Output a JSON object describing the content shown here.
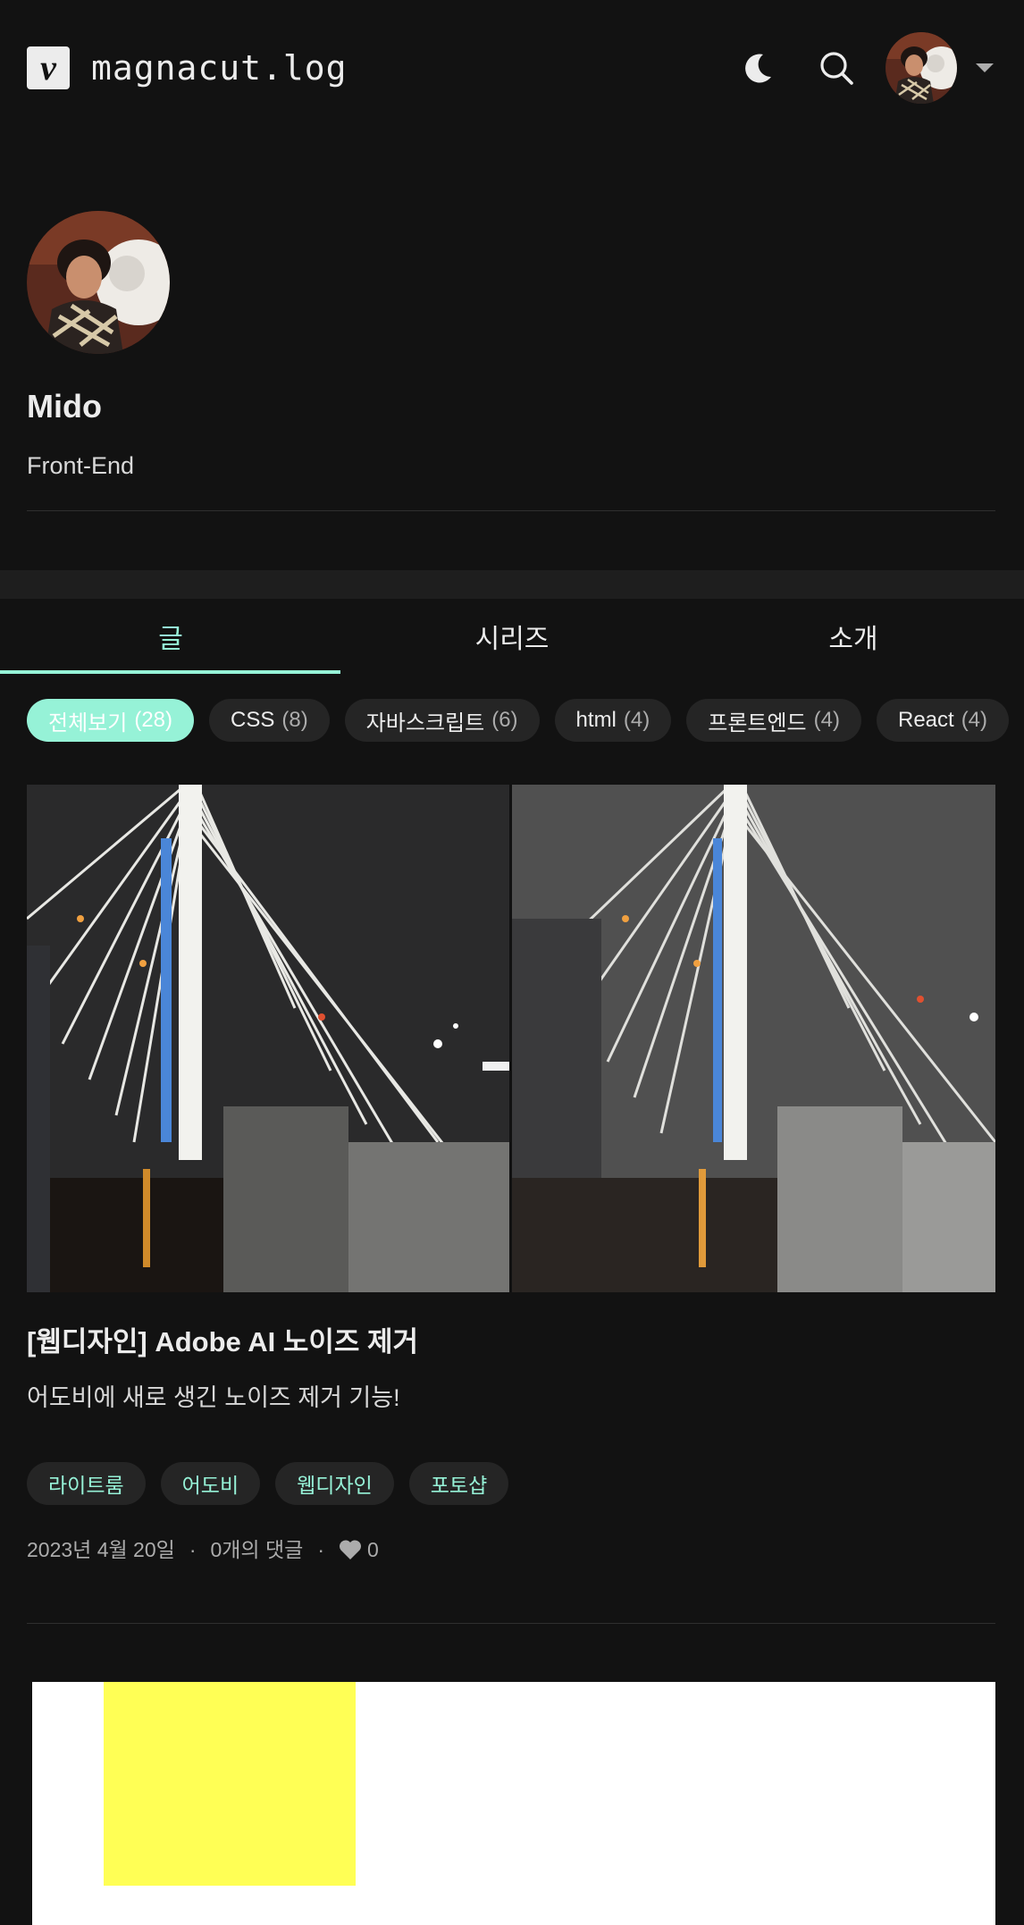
{
  "header": {
    "logo_letter": "v",
    "blog_name": "magnacut.log"
  },
  "profile": {
    "name": "Mido",
    "description": "Front-End"
  },
  "tabs": [
    {
      "label": "글",
      "active": true
    },
    {
      "label": "시리즈",
      "active": false
    },
    {
      "label": "소개",
      "active": false
    }
  ],
  "categories": [
    {
      "label": "전체보기",
      "count": "(28)",
      "active": true
    },
    {
      "label": "CSS",
      "count": "(8)"
    },
    {
      "label": "자바스크립트",
      "count": "(6)"
    },
    {
      "label": "html",
      "count": "(4)"
    },
    {
      "label": "프론트엔드",
      "count": "(4)"
    },
    {
      "label": "React",
      "count": "(4)"
    }
  ],
  "posts": [
    {
      "title": "[웹디자인] Adobe AI 노이즈 제거",
      "description": "어도비에 새로 생긴 노이즈 제거 기능!",
      "tags": [
        "라이트룸",
        "어도비",
        "웹디자인",
        "포토샵"
      ],
      "date": "2023년 4월 20일",
      "comments": "0개의 댓글",
      "likes": "0"
    }
  ],
  "colors": {
    "background": "#121212",
    "accent": "#96F2D7",
    "chip_bg": "#252525",
    "text": "#ECECEC",
    "muted": "#ACACAC"
  },
  "icons": [
    "moon-icon",
    "search-icon",
    "caret-down-icon",
    "heart-icon"
  ]
}
